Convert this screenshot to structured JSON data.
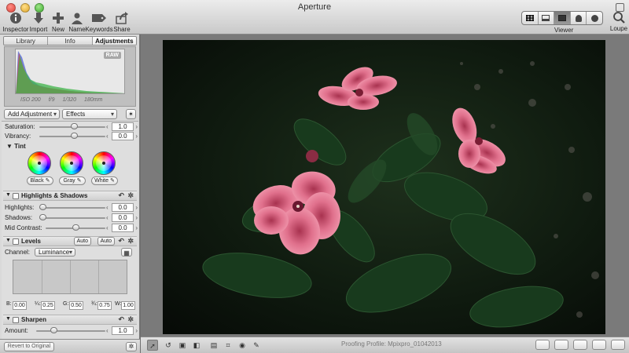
{
  "window": {
    "title": "Aperture"
  },
  "toolbar": {
    "inspector": "Inspector",
    "import": "Import",
    "new": "New",
    "name": "Name",
    "keywords": "Keywords",
    "share": "Share",
    "viewer": "Viewer",
    "loupe": "Loupe"
  },
  "tabs": {
    "library": "Library",
    "info": "Info",
    "adjustments": "Adjustments"
  },
  "histogram": {
    "badge": "RAW",
    "iso": "ISO 200",
    "aperture": "f/9",
    "shutter": "1/320",
    "focal": "180mm",
    "colors": {
      "red": "#e0453f",
      "green": "#3fb44a",
      "blue": "#4a63d8",
      "purple": "#9a4ad8"
    }
  },
  "adjust_bar": {
    "add_adjustment": "Add Adjustment",
    "effects": "Effects"
  },
  "enhance": {
    "saturation_label": "Saturation:",
    "saturation_value": "1.0",
    "vibrancy_label": "Vibrancy:",
    "vibrancy_value": "0.0"
  },
  "tint": {
    "title": "Tint",
    "black": "Black",
    "gray": "Gray",
    "white": "White"
  },
  "highlights_shadows": {
    "title": "Highlights & Shadows",
    "highlights_label": "Highlights:",
    "highlights_value": "0.0",
    "shadows_label": "Shadows:",
    "shadows_value": "0.0",
    "mid_label": "Mid Contrast:",
    "mid_value": "0.0"
  },
  "levels": {
    "title": "Levels",
    "auto1": "Auto",
    "auto2": "Auto",
    "channel_label": "Channel:",
    "channel_value": "Luminance",
    "b_label": "B:",
    "b_value": "0.00",
    "q1_label": "¼:",
    "q1_value": "0.25",
    "g_label": "G:",
    "g_value": "0.50",
    "q3_label": "¾:",
    "q3_value": "0.75",
    "w_label": "W:",
    "w_value": "1.00"
  },
  "sharpen": {
    "title": "Sharpen",
    "amount_label": "Amount:",
    "amount_value": "1.0"
  },
  "footer": {
    "revert": "Revert to Original"
  },
  "status": {
    "proofing": "Proofing Profile: Mpixpro_01042013"
  }
}
